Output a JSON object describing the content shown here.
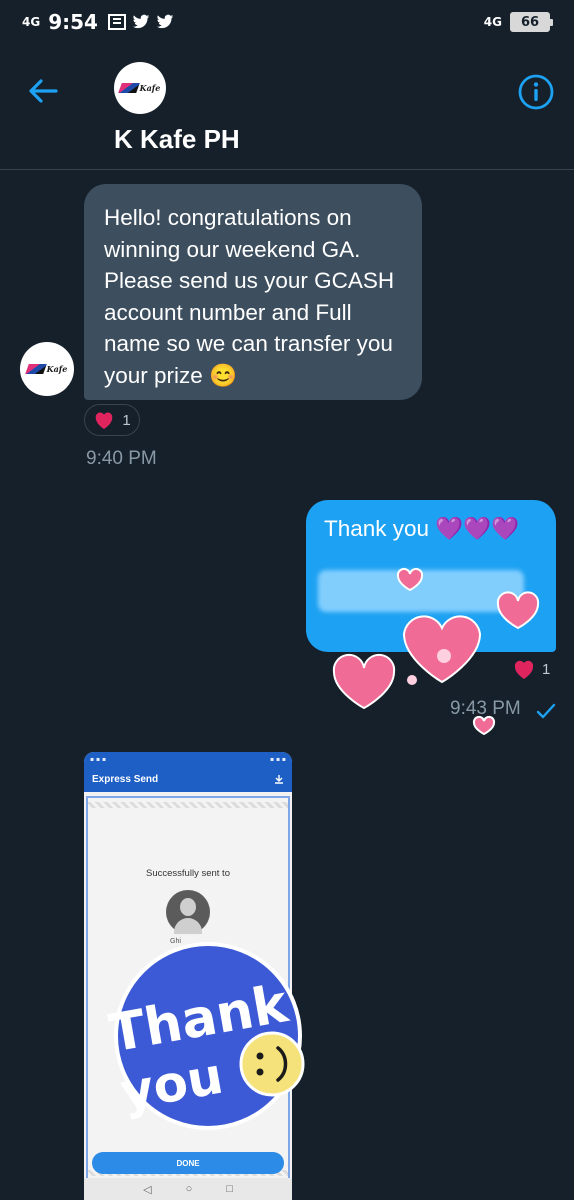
{
  "status_bar": {
    "network": "4G",
    "time": "9:54",
    "network_right": "4G",
    "battery": "66"
  },
  "header": {
    "title": "K Kafe PH",
    "avatar_logo_text": "Kafe"
  },
  "messages": {
    "incoming": {
      "text": "Hello! congratulations on winning our weekend GA. Please send us your GCASH account number and Full name so we can transfer you your prize 😊",
      "reaction_count": "1",
      "time": "9:40 PM"
    },
    "outgoing": {
      "text": "Thank you 💜💜💜",
      "reaction_count": "1",
      "time": "9:43 PM"
    }
  },
  "shared_image": {
    "app_title": "Express Send",
    "sent_label": "Successfully sent to",
    "name_partial": "Ghi",
    "done_label": "DONE",
    "sticker_text_line1": "Thank",
    "sticker_text_line2": "you"
  },
  "colors": {
    "background": "#15202b",
    "incoming_bubble": "#3d4e5e",
    "outgoing_bubble": "#1da1f2",
    "accent": "#1da1f2"
  }
}
